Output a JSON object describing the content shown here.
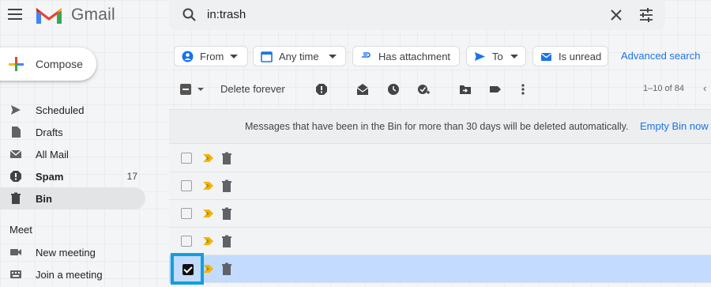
{
  "app": {
    "brand": "Gmail"
  },
  "search": {
    "query": "in:trash"
  },
  "compose": {
    "label": "Compose"
  },
  "sidebar": {
    "items": [
      {
        "label": "Scheduled",
        "icon": "scheduled-icon",
        "active": false,
        "bold": false,
        "count": ""
      },
      {
        "label": "Drafts",
        "icon": "draft-icon",
        "active": false,
        "bold": false,
        "count": ""
      },
      {
        "label": "All Mail",
        "icon": "mail-icon",
        "active": false,
        "bold": false,
        "count": ""
      },
      {
        "label": "Spam",
        "icon": "spam-icon",
        "active": false,
        "bold": true,
        "count": "17"
      },
      {
        "label": "Bin",
        "icon": "trash-icon",
        "active": true,
        "bold": true,
        "count": ""
      }
    ],
    "meet": {
      "heading": "Meet",
      "items": [
        {
          "label": "New meeting",
          "icon": "video-camera-icon"
        },
        {
          "label": "Join a meeting",
          "icon": "keyboard-icon"
        }
      ]
    }
  },
  "filters": {
    "from": "From",
    "any_time": "Any time",
    "has_attachment": "Has attachment",
    "to": "To",
    "is_unread": "Is unread",
    "advanced_search": "Advanced search"
  },
  "toolbar": {
    "delete_forever": "Delete forever",
    "range": "1–10 of 84",
    "prev": "‹"
  },
  "banner": {
    "message": "Messages that have been in the Bin for more than 30 days will be deleted automatically.",
    "action": "Empty Bin now"
  },
  "rows": [
    {
      "selected": false
    },
    {
      "selected": false
    },
    {
      "selected": false
    },
    {
      "selected": false
    },
    {
      "selected": true
    }
  ],
  "colors": {
    "accent": "#1a73e8",
    "selected_row": "#c2dbff",
    "highlight_box": "#129fdb",
    "importance_marker": "#f4b400"
  }
}
